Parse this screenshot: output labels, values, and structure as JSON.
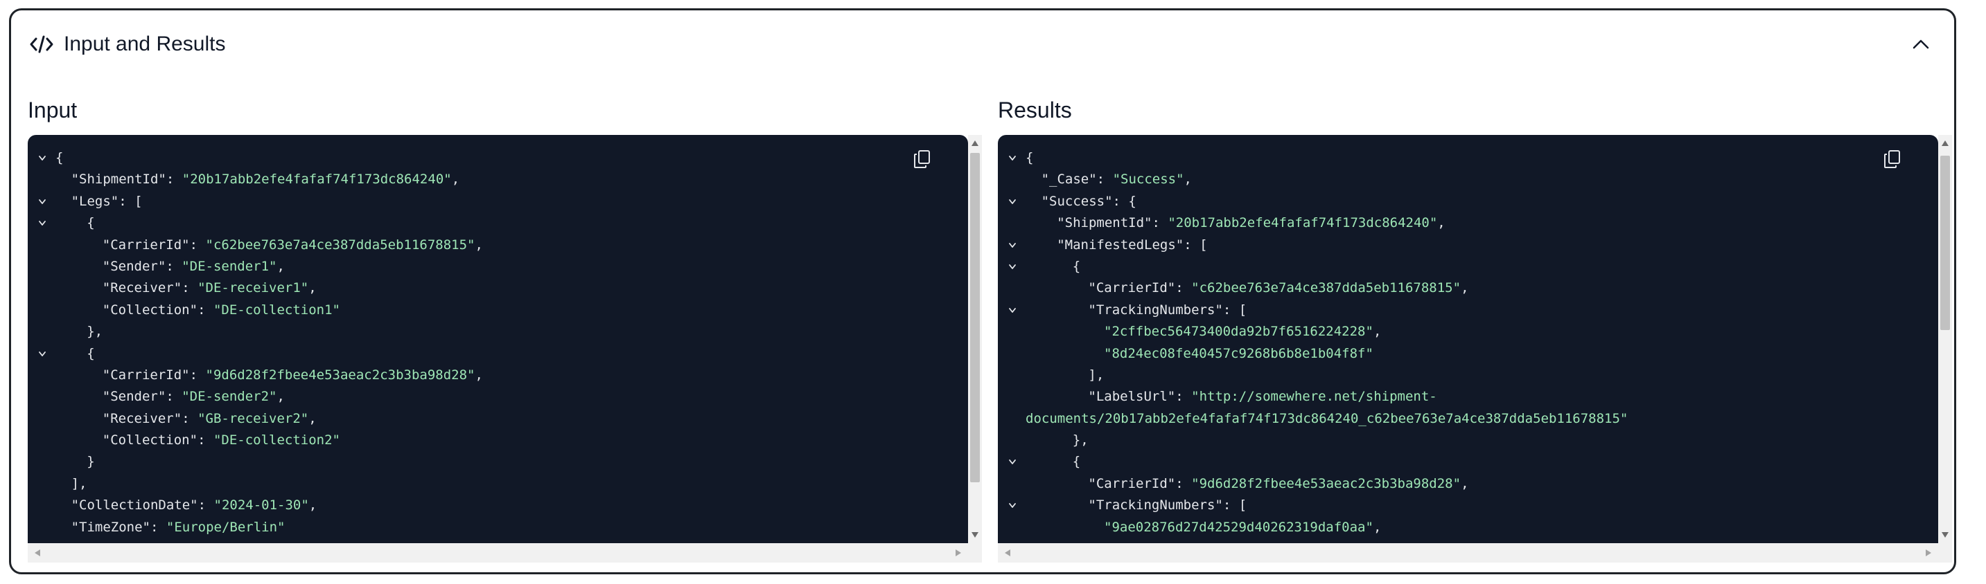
{
  "header": {
    "title": "Input and Results",
    "icon": "code-icon",
    "collapse_icon": "chevron-up-icon"
  },
  "input": {
    "title": "Input",
    "lines": [
      {
        "indent": 0,
        "fold": true,
        "parts": [
          [
            "{",
            "p"
          ]
        ]
      },
      {
        "indent": 1,
        "fold": false,
        "parts": [
          [
            "\"ShipmentId\"",
            "k"
          ],
          [
            ": ",
            "p"
          ],
          [
            "\"20b17abb2efe4fafaf74f173dc864240\"",
            "s"
          ],
          [
            ",",
            "p"
          ]
        ]
      },
      {
        "indent": 1,
        "fold": true,
        "parts": [
          [
            "\"Legs\"",
            "k"
          ],
          [
            ": [",
            "p"
          ]
        ]
      },
      {
        "indent": 2,
        "fold": true,
        "parts": [
          [
            "{",
            "p"
          ]
        ]
      },
      {
        "indent": 3,
        "fold": false,
        "parts": [
          [
            "\"CarrierId\"",
            "k"
          ],
          [
            ": ",
            "p"
          ],
          [
            "\"c62bee763e7a4ce387dda5eb11678815\"",
            "s"
          ],
          [
            ",",
            "p"
          ]
        ]
      },
      {
        "indent": 3,
        "fold": false,
        "parts": [
          [
            "\"Sender\"",
            "k"
          ],
          [
            ": ",
            "p"
          ],
          [
            "\"DE-sender1\"",
            "s"
          ],
          [
            ",",
            "p"
          ]
        ]
      },
      {
        "indent": 3,
        "fold": false,
        "parts": [
          [
            "\"Receiver\"",
            "k"
          ],
          [
            ": ",
            "p"
          ],
          [
            "\"DE-receiver1\"",
            "s"
          ],
          [
            ",",
            "p"
          ]
        ]
      },
      {
        "indent": 3,
        "fold": false,
        "parts": [
          [
            "\"Collection\"",
            "k"
          ],
          [
            ": ",
            "p"
          ],
          [
            "\"DE-collection1\"",
            "s"
          ]
        ]
      },
      {
        "indent": 2,
        "fold": false,
        "parts": [
          [
            "},",
            "p"
          ]
        ]
      },
      {
        "indent": 2,
        "fold": true,
        "parts": [
          [
            "{",
            "p"
          ]
        ]
      },
      {
        "indent": 3,
        "fold": false,
        "parts": [
          [
            "\"CarrierId\"",
            "k"
          ],
          [
            ": ",
            "p"
          ],
          [
            "\"9d6d28f2fbee4e53aeac2c3b3ba98d28\"",
            "s"
          ],
          [
            ",",
            "p"
          ]
        ]
      },
      {
        "indent": 3,
        "fold": false,
        "parts": [
          [
            "\"Sender\"",
            "k"
          ],
          [
            ": ",
            "p"
          ],
          [
            "\"DE-sender2\"",
            "s"
          ],
          [
            ",",
            "p"
          ]
        ]
      },
      {
        "indent": 3,
        "fold": false,
        "parts": [
          [
            "\"Receiver\"",
            "k"
          ],
          [
            ": ",
            "p"
          ],
          [
            "\"GB-receiver2\"",
            "s"
          ],
          [
            ",",
            "p"
          ]
        ]
      },
      {
        "indent": 3,
        "fold": false,
        "parts": [
          [
            "\"Collection\"",
            "k"
          ],
          [
            ": ",
            "p"
          ],
          [
            "\"DE-collection2\"",
            "s"
          ]
        ]
      },
      {
        "indent": 2,
        "fold": false,
        "parts": [
          [
            "}",
            "p"
          ]
        ]
      },
      {
        "indent": 1,
        "fold": false,
        "parts": [
          [
            "],",
            "p"
          ]
        ]
      },
      {
        "indent": 1,
        "fold": false,
        "parts": [
          [
            "\"CollectionDate\"",
            "k"
          ],
          [
            ": ",
            "p"
          ],
          [
            "\"2024-01-30\"",
            "s"
          ],
          [
            ",",
            "p"
          ]
        ]
      },
      {
        "indent": 1,
        "fold": false,
        "parts": [
          [
            "\"TimeZone\"",
            "k"
          ],
          [
            ": ",
            "p"
          ],
          [
            "\"Europe/Berlin\"",
            "s"
          ]
        ]
      }
    ]
  },
  "results": {
    "title": "Results",
    "lines": [
      {
        "indent": 0,
        "fold": true,
        "parts": [
          [
            "{",
            "p"
          ]
        ]
      },
      {
        "indent": 1,
        "fold": false,
        "parts": [
          [
            "\"_Case\"",
            "k"
          ],
          [
            ": ",
            "p"
          ],
          [
            "\"Success\"",
            "s"
          ],
          [
            ",",
            "p"
          ]
        ]
      },
      {
        "indent": 1,
        "fold": true,
        "parts": [
          [
            "\"Success\"",
            "k"
          ],
          [
            ": {",
            "p"
          ]
        ]
      },
      {
        "indent": 2,
        "fold": false,
        "parts": [
          [
            "\"ShipmentId\"",
            "k"
          ],
          [
            ": ",
            "p"
          ],
          [
            "\"20b17abb2efe4fafaf74f173dc864240\"",
            "s"
          ],
          [
            ",",
            "p"
          ]
        ]
      },
      {
        "indent": 2,
        "fold": true,
        "parts": [
          [
            "\"ManifestedLegs\"",
            "k"
          ],
          [
            ": [",
            "p"
          ]
        ]
      },
      {
        "indent": 3,
        "fold": true,
        "parts": [
          [
            "{",
            "p"
          ]
        ]
      },
      {
        "indent": 4,
        "fold": false,
        "parts": [
          [
            "\"CarrierId\"",
            "k"
          ],
          [
            ": ",
            "p"
          ],
          [
            "\"c62bee763e7a4ce387dda5eb11678815\"",
            "s"
          ],
          [
            ",",
            "p"
          ]
        ]
      },
      {
        "indent": 4,
        "fold": true,
        "parts": [
          [
            "\"TrackingNumbers\"",
            "k"
          ],
          [
            ": [",
            "p"
          ]
        ]
      },
      {
        "indent": 5,
        "fold": false,
        "parts": [
          [
            "\"2cffbec56473400da92b7f6516224228\"",
            "s"
          ],
          [
            ",",
            "p"
          ]
        ]
      },
      {
        "indent": 5,
        "fold": false,
        "parts": [
          [
            "\"8d24ec08fe40457c9268b6b8e1b04f8f\"",
            "s"
          ]
        ]
      },
      {
        "indent": 4,
        "fold": false,
        "parts": [
          [
            "],",
            "p"
          ]
        ]
      },
      {
        "indent": 4,
        "fold": false,
        "parts": [
          [
            "\"LabelsUrl\"",
            "k"
          ],
          [
            ": ",
            "p"
          ],
          [
            "\"http://somewhere.net/shipment-",
            "s"
          ]
        ]
      },
      {
        "indent": 0,
        "fold": false,
        "parts": [
          [
            "documents/20b17abb2efe4fafaf74f173dc864240_c62bee763e7a4ce387dda5eb11678815\"",
            "s"
          ]
        ]
      },
      {
        "indent": 3,
        "fold": false,
        "parts": [
          [
            "},",
            "p"
          ]
        ]
      },
      {
        "indent": 3,
        "fold": true,
        "parts": [
          [
            "{",
            "p"
          ]
        ]
      },
      {
        "indent": 4,
        "fold": false,
        "parts": [
          [
            "\"CarrierId\"",
            "k"
          ],
          [
            ": ",
            "p"
          ],
          [
            "\"9d6d28f2fbee4e53aeac2c3b3ba98d28\"",
            "s"
          ],
          [
            ",",
            "p"
          ]
        ]
      },
      {
        "indent": 4,
        "fold": true,
        "parts": [
          [
            "\"TrackingNumbers\"",
            "k"
          ],
          [
            ": [",
            "p"
          ]
        ]
      },
      {
        "indent": 5,
        "fold": false,
        "parts": [
          [
            "\"9ae02876d27d42529d40262319daf0aa\"",
            "s"
          ],
          [
            ",",
            "p"
          ]
        ]
      }
    ]
  }
}
